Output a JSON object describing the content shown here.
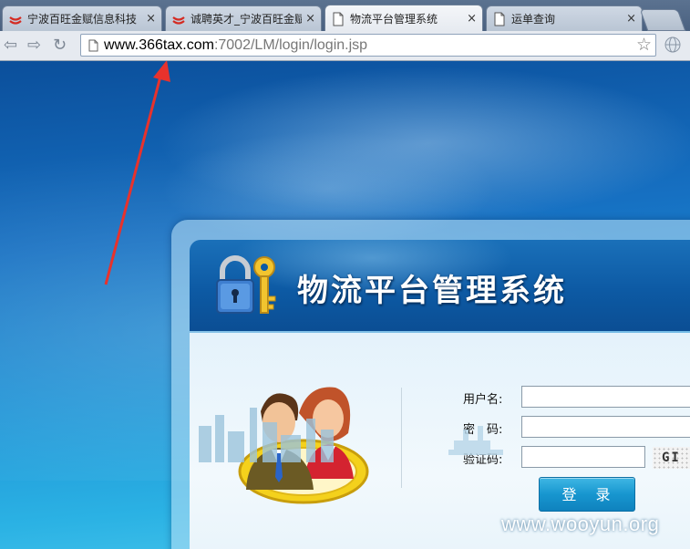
{
  "browser": {
    "tabs": [
      {
        "title": "宁波百旺金赋信息科技",
        "favicon": "red-logo-icon",
        "active": false
      },
      {
        "title": "诚聘英才_宁波百旺金赋",
        "favicon": "red-logo-icon",
        "active": false
      },
      {
        "title": "物流平台管理系统",
        "favicon": "page-icon",
        "active": true
      },
      {
        "title": "运单查询",
        "favicon": "page-icon",
        "active": false
      }
    ],
    "close_glyph": "×",
    "url_host": "www.366tax.com",
    "url_rest": ":7002/LM/login/login.jsp"
  },
  "login": {
    "title": "物流平台管理系统",
    "username_label": "用户名:",
    "password_label": "密　码:",
    "captcha_label": "验证码:",
    "captcha_text": "GI A",
    "login_button": "登 录"
  },
  "watermark": "www.wooyun.org",
  "colors": {
    "accent": "#1796cf",
    "header_blue": "#0d5aa4",
    "arrow": "#e8322c"
  }
}
